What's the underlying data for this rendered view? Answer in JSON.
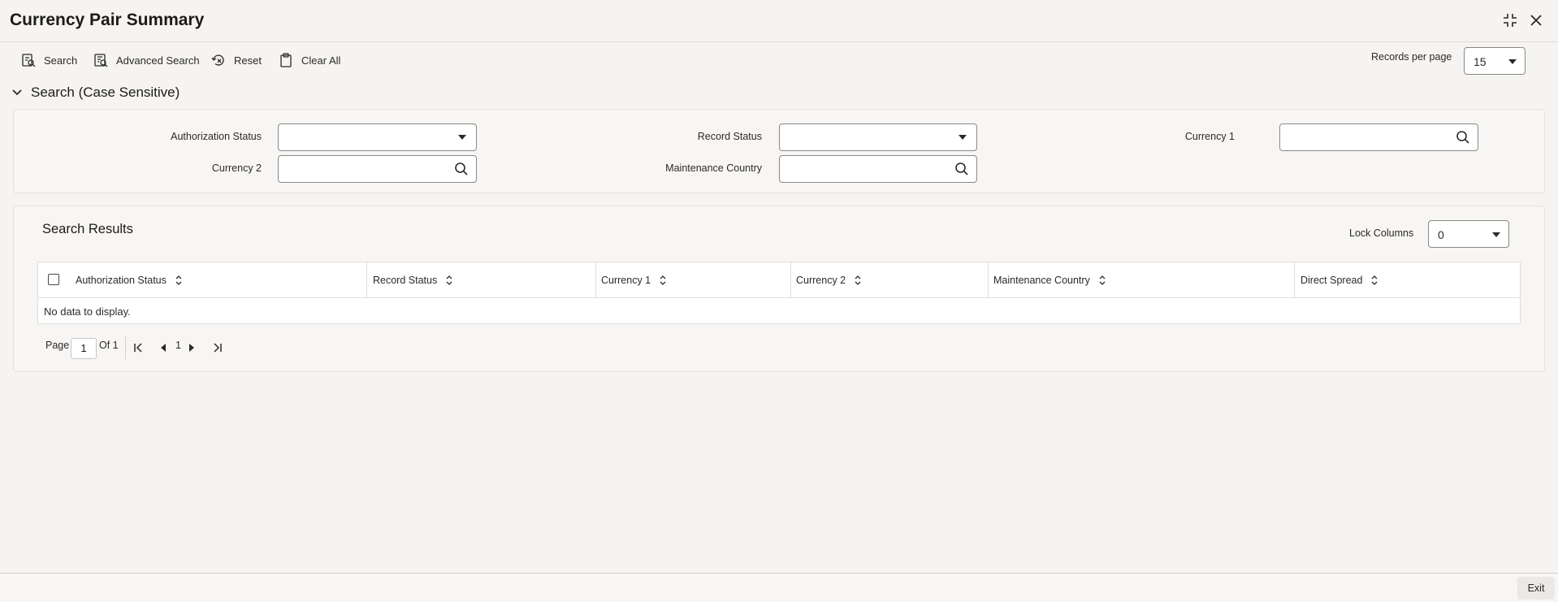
{
  "header": {
    "title": "Currency Pair Summary"
  },
  "toolbar": {
    "search_label": "Search",
    "advanced_search_label": "Advanced Search",
    "reset_label": "Reset",
    "clear_all_label": "Clear All",
    "records_per_page_label": "Records per page",
    "records_per_page_value": "15"
  },
  "search_section": {
    "title": "Search (Case Sensitive)",
    "fields": {
      "authorization_status": {
        "label": "Authorization Status",
        "value": ""
      },
      "record_status": {
        "label": "Record Status",
        "value": ""
      },
      "currency_1": {
        "label": "Currency 1",
        "value": ""
      },
      "currency_2": {
        "label": "Currency 2",
        "value": ""
      },
      "maintenance_country": {
        "label": "Maintenance Country",
        "value": ""
      }
    }
  },
  "results": {
    "title": "Search Results",
    "lock_columns_label": "Lock Columns",
    "lock_columns_value": "0",
    "columns": [
      "Authorization Status",
      "Record Status",
      "Currency 1",
      "Currency 2",
      "Maintenance Country",
      "Direct Spread"
    ],
    "empty_message": "No data to display."
  },
  "pagination": {
    "page_label": "Page",
    "page_value": "1",
    "of_label": "Of 1",
    "current_page": "1"
  },
  "footer": {
    "exit_label": "Exit"
  },
  "colors": {
    "background": "#f5f4f2",
    "text": "#161513",
    "border": "#8c8984"
  }
}
